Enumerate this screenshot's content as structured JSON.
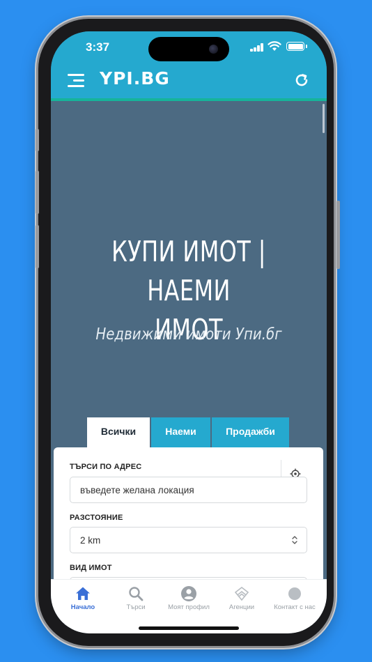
{
  "status_bar": {
    "time": "3:37"
  },
  "header": {
    "logo": "YPI.BG"
  },
  "hero": {
    "title_line1": "КУПИ ИМОТ | НАЕМИ",
    "title_line2": "ИМОТ",
    "subtitle": "Недвижими имоти Упи.бг"
  },
  "tabs": [
    {
      "label": "Всички",
      "active": true
    },
    {
      "label": "Наеми",
      "active": false
    },
    {
      "label": "Продажби",
      "active": false
    }
  ],
  "search_form": {
    "address_label": "ТЪРСИ ПО АДРЕС",
    "address_placeholder": "въведете желана локация",
    "distance_label": "РАЗСТОЯНИЕ",
    "distance_value": "2 km",
    "property_type_label": "ВИД ИМОТ"
  },
  "bottom_nav": [
    {
      "label": "Начало",
      "icon": "home-icon",
      "active": true
    },
    {
      "label": "Търси",
      "icon": "search-icon",
      "active": false
    },
    {
      "label": "Моят профил",
      "icon": "profile-icon",
      "active": false
    },
    {
      "label": "Агенции",
      "icon": "agencies-icon",
      "active": false
    },
    {
      "label": "Контакт с нас",
      "icon": "contact-icon",
      "active": false
    }
  ],
  "colors": {
    "primary": "#25a9cf",
    "accent_line": "#16b49a",
    "hero_background": "#4c6a82",
    "nav_active": "#3a6fd6",
    "page_background": "#2b8ff0"
  }
}
